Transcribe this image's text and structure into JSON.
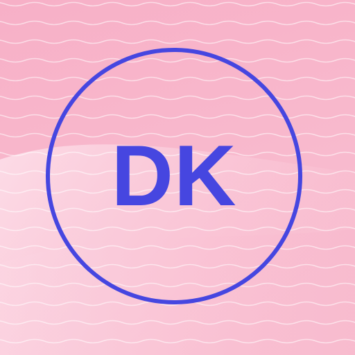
{
  "app_icon": {
    "monogram": "DK",
    "colors": {
      "accent": "#4646e0",
      "background_top": "#f8b2c9",
      "background_bottom": "#fbc6d6",
      "wave_lines": "#ffffff"
    },
    "pattern": "wavy-lines",
    "badge_shape": "circle-outline"
  }
}
